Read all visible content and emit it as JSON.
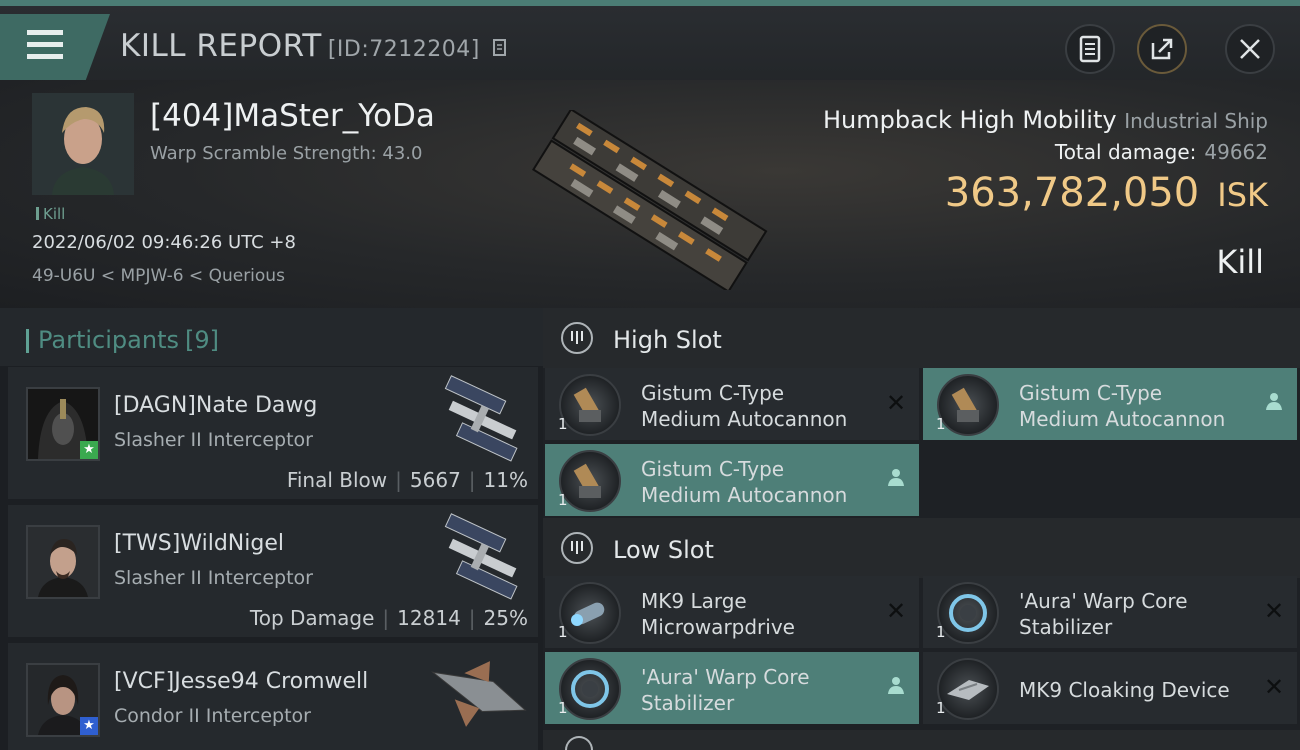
{
  "header": {
    "title": "KILL REPORT",
    "report_id": "[ID:7212204]"
  },
  "victim": {
    "name": "[404]MaSter_YoDa",
    "scramble": "Warp Scramble Strength: 43.0",
    "kill_tag": "Kill",
    "datetime": "2022/06/02 09:46:26 UTC +8",
    "location": "49-U6U < MPJW-6 < Querious"
  },
  "ship": {
    "name": "Humpback High Mobility",
    "class": "Industrial Ship",
    "total_damage_label": "Total damage:",
    "total_damage": "49662",
    "isk_value": "363,782,050",
    "isk_unit": "ISK",
    "result": "Kill"
  },
  "participants": {
    "title": "Participants",
    "count": "[9]",
    "items": [
      {
        "name": "[DAGN]Nate Dawg",
        "ship": "Slasher II Interceptor",
        "stat_label": "Final Blow",
        "damage": "5667",
        "percent": "11%",
        "star_color": "#3aa94f"
      },
      {
        "name": "[TWS]WildNigel",
        "ship": "Slasher II Interceptor",
        "stat_label": "Top Damage",
        "damage": "12814",
        "percent": "25%",
        "star_color": ""
      },
      {
        "name": "[VCF]Jesse94 Cromwell",
        "ship": "Condor II Interceptor",
        "stat_label": "",
        "damage": "",
        "percent": "",
        "star_color": "#2f5fd0"
      }
    ]
  },
  "slots": {
    "high": {
      "title": "High Slot",
      "modules": [
        {
          "line1": "Gistum C-Type",
          "line2": "Medium Autocannon",
          "qty": "1",
          "state": "destroyed"
        },
        {
          "line1": "Gistum C-Type",
          "line2": "Medium Autocannon",
          "qty": "1",
          "state": "dropped"
        },
        {
          "line1": "Gistum C-Type",
          "line2": "Medium Autocannon",
          "qty": "1",
          "state": "dropped"
        }
      ]
    },
    "low": {
      "title": "Low Slot",
      "modules": [
        {
          "line1": "MK9 Large",
          "line2": "Microwarpdrive",
          "qty": "1",
          "state": "destroyed"
        },
        {
          "line1": "'Aura' Warp Core",
          "line2": "Stabilizer",
          "qty": "1",
          "state": "destroyed"
        },
        {
          "line1": "'Aura' Warp Core",
          "line2": "Stabilizer",
          "qty": "1",
          "state": "dropped"
        },
        {
          "line1": "MK9 Cloaking Device",
          "line2": "",
          "qty": "1",
          "state": "destroyed"
        }
      ]
    }
  }
}
